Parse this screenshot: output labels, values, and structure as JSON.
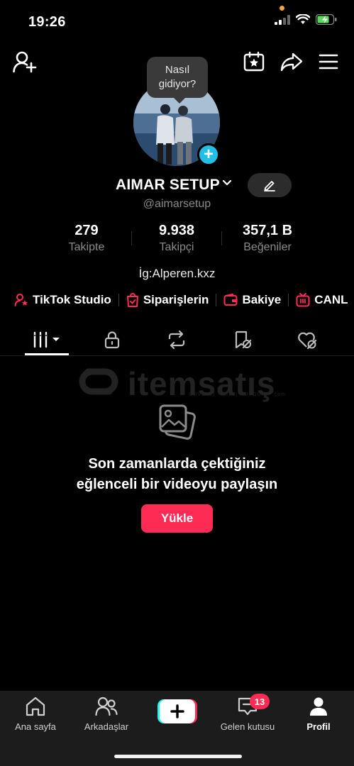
{
  "status_bar": {
    "time": "19:26"
  },
  "profile": {
    "bubble_text": "Nasıl gidiyor?",
    "display_name": "AIMAR SETUP",
    "username": "@aimarsetup",
    "bio": "İg:Alperen.kxz"
  },
  "stats": [
    {
      "value": "279",
      "label": "Takipte"
    },
    {
      "value": "9.938",
      "label": "Takipçi"
    },
    {
      "value": "357,1 B",
      "label": "Beğeniler"
    }
  ],
  "links": [
    {
      "label": "TikTok Studio",
      "icon": "studio-icon"
    },
    {
      "label": "Siparişlerin",
      "icon": "orders-icon"
    },
    {
      "label": "Bakiye",
      "icon": "wallet-icon"
    },
    {
      "label": "CANL",
      "icon": "live-icon"
    }
  ],
  "tabs": [
    "videos-grid-icon",
    "lock-icon",
    "repost-icon",
    "favorites-icon",
    "liked-icon"
  ],
  "watermark": {
    "text": "itemsatış",
    "sub": "GÜVENLİ · HIZLI · UYGUN · .com"
  },
  "empty_state": {
    "line1": "Son zamanlarda çektiğiniz",
    "line2": "eğlenceli bir videoyu paylaşın",
    "button": "Yükle"
  },
  "bottom_nav": {
    "home": "Ana sayfa",
    "friends": "Arkadaşlar",
    "inbox": "Gelen kutusu",
    "inbox_badge": "13",
    "profile": "Profil"
  },
  "colors": {
    "accent": "#fe2c55",
    "avatar_plus": "#21c0e8",
    "battery": "#5cd95c"
  }
}
